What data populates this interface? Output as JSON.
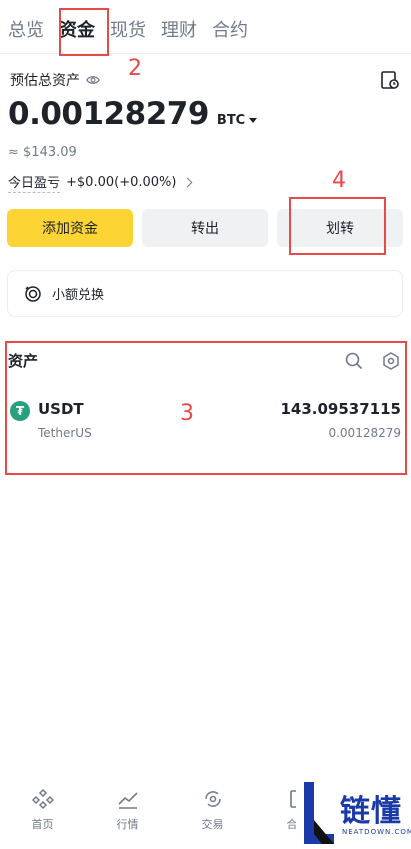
{
  "tabs": [
    {
      "label": "总览",
      "active": false
    },
    {
      "label": "资金",
      "active": true
    },
    {
      "label": "现货",
      "active": false
    },
    {
      "label": "理财",
      "active": false
    },
    {
      "label": "合约",
      "active": false
    }
  ],
  "overview": {
    "est_label": "预估总资产",
    "balance": "0.00128279",
    "currency": "BTC",
    "fiat": "≈ $143.09",
    "pnl_label": "今日盈亏",
    "pnl_value": "+$0.00(+0.00%)"
  },
  "actions": {
    "add": "添加资金",
    "out": "转出",
    "transfer": "划转"
  },
  "small_convert": "小额兑换",
  "assets": {
    "title": "资产",
    "rows": [
      {
        "symbol": "USDT",
        "name": "TetherUS",
        "amount": "143.09537115",
        "btc": "0.00128279"
      }
    ]
  },
  "bottom_nav": [
    {
      "label": "首页",
      "icon": "home-icon"
    },
    {
      "label": "行情",
      "icon": "markets-icon"
    },
    {
      "label": "交易",
      "icon": "trade-icon"
    },
    {
      "label": "合约",
      "icon": "futures-icon"
    }
  ],
  "annotations": {
    "n2": "2",
    "n3": "3",
    "n4": "4"
  },
  "watermark": {
    "title": "链懂",
    "subtitle": "NEATDOWN.COM"
  },
  "colors": {
    "accent": "#fcd535",
    "annotation": "#e84a4a",
    "usdt": "#26a17b",
    "watermark": "#1a3aa8"
  }
}
